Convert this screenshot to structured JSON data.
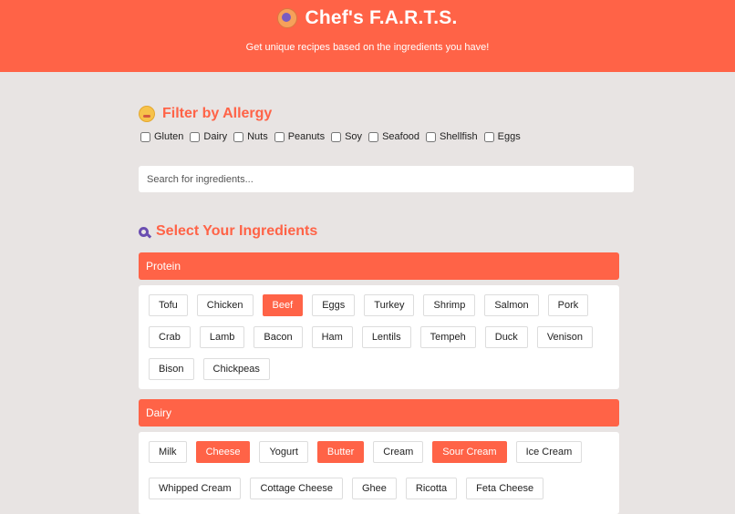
{
  "header": {
    "title": "Chef's F.A.R.T.S.",
    "subtitle": "Get unique recipes based on the ingredients you have!",
    "accent_color": "#ff6347"
  },
  "allergy": {
    "title": "Filter by Allergy",
    "options": [
      "Gluten",
      "Dairy",
      "Nuts",
      "Peanuts",
      "Soy",
      "Seafood",
      "Shellfish",
      "Eggs"
    ]
  },
  "search": {
    "placeholder": "Search for ingredients..."
  },
  "ingredients": {
    "title": "Select Your Ingredients",
    "categories": [
      {
        "name": "Protein",
        "items": [
          "Tofu",
          "Chicken",
          "Beef",
          "Eggs",
          "Turkey",
          "Shrimp",
          "Salmon",
          "Pork",
          "Crab",
          "Lamb",
          "Bacon",
          "Ham",
          "Lentils",
          "Tempeh",
          "Duck",
          "Venison",
          "Bison",
          "Chickpeas"
        ],
        "selected": [
          "Beef"
        ]
      },
      {
        "name": "Dairy",
        "items": [
          "Milk",
          "Cheese",
          "Yogurt",
          "Butter",
          "Cream",
          "Sour Cream",
          "Ice Cream",
          "Whipped Cream",
          "Cottage Cheese",
          "Ghee",
          "Ricotta",
          "Feta Cheese"
        ],
        "selected": [
          "Cheese",
          "Butter",
          "Sour Cream"
        ]
      }
    ]
  }
}
